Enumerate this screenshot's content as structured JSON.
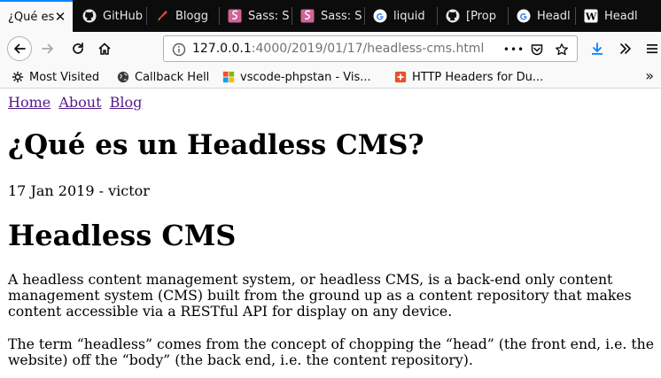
{
  "browser": {
    "tabs": [
      {
        "title": "¿Qué es",
        "icon": "generic-page-icon",
        "active": true
      },
      {
        "title": "GitHub",
        "icon": "github-icon",
        "active": false
      },
      {
        "title": "Blogg",
        "icon": "pen-icon",
        "active": false
      },
      {
        "title": "Sass: S",
        "icon": "sass-icon",
        "active": false
      },
      {
        "title": "Sass: S",
        "icon": "sass-icon",
        "active": false
      },
      {
        "title": "liquid",
        "icon": "google-icon",
        "active": false
      },
      {
        "title": "[Prop",
        "icon": "github-icon",
        "active": false
      },
      {
        "title": "Headl",
        "icon": "google-icon",
        "active": false
      },
      {
        "title": "Headl",
        "icon": "wikipedia-icon",
        "active": false
      }
    ],
    "url": {
      "host": "127.0.0.1",
      "rest": ":4000/2019/01/17/headless-cms.html"
    },
    "page_actions_label": "•••",
    "bookmarks": [
      {
        "label": "Most Visited",
        "icon": "gear-icon"
      },
      {
        "label": "Callback Hell",
        "icon": "globe-icon"
      },
      {
        "label": "vscode-phpstan - Vis...",
        "icon": "windows-icon"
      },
      {
        "label": "HTTP Headers for Du...",
        "icon": "plus-badge-icon"
      }
    ],
    "colors": {
      "accent": "#0a84ff",
      "tabstrip": "#0c0c0d",
      "toolbar": "#f9f9fa"
    }
  },
  "page": {
    "nav": [
      "Home",
      "About",
      "Blog"
    ],
    "title": "¿Qué es un Headless CMS?",
    "meta": "17 Jan 2019 - victor",
    "heading": "Headless CMS",
    "paragraphs": [
      "A headless content management system, or headless CMS, is a back-end only content management system (CMS) built from the ground up as a content repository that makes content accessible via a RESTful API for display on any device.",
      "The term “headless” comes from the concept of chopping the “head” (the front end, i.e. the website) off the “body” (the back end, i.e. the content repository)."
    ],
    "link_color": "#551a8b"
  }
}
